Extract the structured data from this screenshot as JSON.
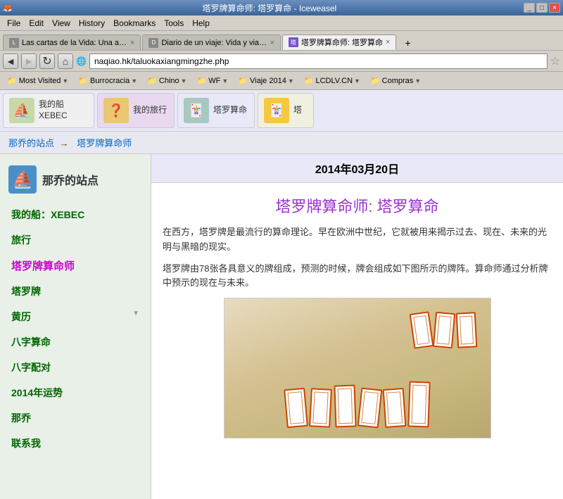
{
  "titlebar": {
    "title": "塔罗牌算命师: 塔罗算命 - Iceweasel",
    "min_label": "_",
    "max_label": "□",
    "close_label": "×"
  },
  "menubar": {
    "items": [
      "File",
      "Edit",
      "View",
      "History",
      "Bookmarks",
      "Tools",
      "Help"
    ]
  },
  "tabs": [
    {
      "id": "tab1",
      "label": "Las cartas de la Vida: Una ay...",
      "favicon": "L",
      "active": false
    },
    {
      "id": "tab2",
      "label": "Diario de un viaje: Vida y viaje...",
      "favicon": "D",
      "active": false
    },
    {
      "id": "tab3",
      "label": "塔罗牌算命师: 塔罗算命",
      "favicon": "塔",
      "active": true
    }
  ],
  "addressbar": {
    "back_icon": "◄",
    "forward_icon": "►",
    "url": "naqiao.hk/taluokaxiangmingzhe.php",
    "refresh_icon": "↻",
    "home_icon": "⌂",
    "star_icon": "☆"
  },
  "bookmarksbar": {
    "items": [
      {
        "label": "Most Visited",
        "has_arrow": true
      },
      {
        "label": "Burrocracia",
        "has_arrow": true
      },
      {
        "label": "Chino",
        "has_arrow": true
      },
      {
        "label": "WF",
        "has_arrow": true
      },
      {
        "label": "Viaje 2014",
        "has_arrow": true
      },
      {
        "label": "LCDLV.CN",
        "has_arrow": true
      },
      {
        "label": "Compras",
        "has_arrow": true
      }
    ]
  },
  "site_nav": {
    "cards": [
      {
        "icon": "🚢",
        "text": "我的船\nXEBEC",
        "bg": "blue"
      },
      {
        "icon": "❓",
        "text": "我的旅行",
        "bg": "teal"
      },
      {
        "icon": "🃏",
        "text": "塔罗算命",
        "bg": "purple"
      },
      {
        "icon": "🃏",
        "text": "塔",
        "bg": "orange"
      }
    ]
  },
  "breadcrumb": {
    "home": "那乔的站点",
    "arrow": "→",
    "current": "塔罗牌算命师"
  },
  "sidebar": {
    "logo_text": "那乔的站点",
    "items": [
      {
        "label": "我的船：XEBEC",
        "active": false
      },
      {
        "label": "旅行",
        "active": false
      },
      {
        "label": "塔罗牌算命师",
        "active": true
      },
      {
        "label": "塔罗牌",
        "active": false
      },
      {
        "label": "黄历",
        "active": false,
        "has_dropdown": true
      },
      {
        "label": "八字算命",
        "active": false
      },
      {
        "label": "八字配对",
        "active": false
      },
      {
        "label": "2014年运势",
        "active": false
      },
      {
        "label": "那乔",
        "active": false
      },
      {
        "label": "联系我",
        "active": false
      }
    ]
  },
  "article": {
    "date": "2014年03月20日",
    "title": "塔罗牌算命师: 塔罗算命",
    "paragraph1": "在西方，塔罗牌是最流行的算命理论。早在欧洲中世纪，它就被用来揭示过去、现在、未来的光明与黑暗的现实。",
    "paragraph2": "塔罗牌由78张各具意义的牌组成，预测的时候，牌会组成如下图所示的牌阵。算命师通过分析牌中预示的现在与未来。"
  },
  "colors": {
    "accent_purple": "#9933cc",
    "sidebar_green": "#006600",
    "active_purple": "#cc00cc",
    "link_blue": "#0066cc",
    "tab_bg": "#d4d0c8"
  }
}
